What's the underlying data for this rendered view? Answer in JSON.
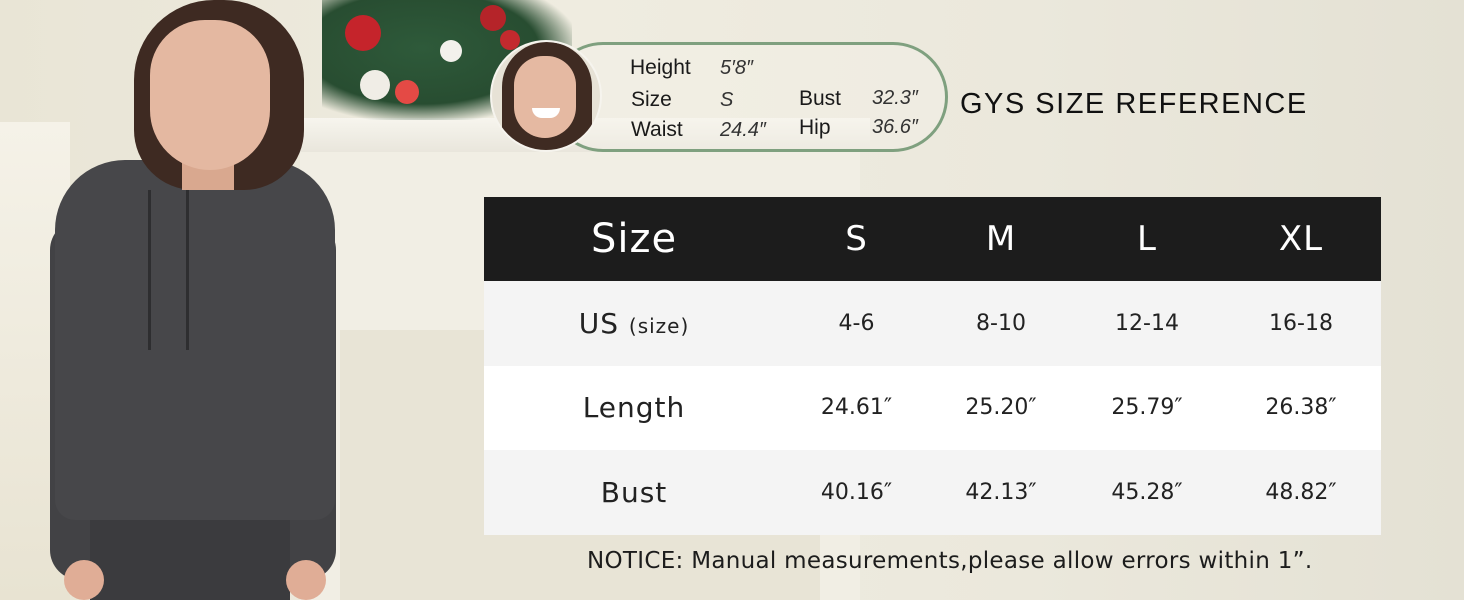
{
  "model_info": {
    "height_label": "Height",
    "height_value": "5′8″",
    "size_label": "Size",
    "size_value": "S",
    "waist_label": "Waist",
    "waist_value": "24.4″",
    "bust_label": "Bust",
    "bust_value": "32.3″",
    "hip_label": "Hip",
    "hip_value": "36.6″"
  },
  "reference_title": "GYS SIZE REFERENCE",
  "table": {
    "header": {
      "label": "Size",
      "columns": [
        "S",
        "M",
        "L",
        "XL"
      ]
    },
    "rows": [
      {
        "label": "US",
        "sublabel": "(size)",
        "values": [
          "4-6",
          "8-10",
          "12-14",
          "16-18"
        ]
      },
      {
        "label": "Length",
        "sublabel": "",
        "values": [
          "24.61″",
          "25.20″",
          "25.79″",
          "26.38″"
        ]
      },
      {
        "label": "Bust",
        "sublabel": "",
        "values": [
          "40.16″",
          "42.13″",
          "45.28″",
          "48.82″"
        ]
      }
    ]
  },
  "notice": "NOTICE: Manual measurements,please allow errors within 1”.",
  "colors": {
    "header_bg": "#1c1c1c",
    "pill_border": "#7fa07f",
    "row_alt": "#f4f4f4"
  }
}
